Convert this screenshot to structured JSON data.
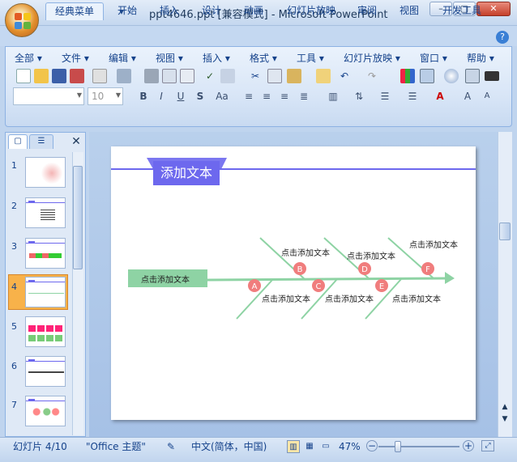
{
  "window": {
    "title": "ppt4646.ppt [兼容模式] - Microsoft PowerPoint",
    "buttons": {
      "minimize": "–",
      "maximize": "▢",
      "close": "✕"
    }
  },
  "quick_access": {
    "save": "💾",
    "undo": "↶",
    "redo": "↻",
    "more": "▾"
  },
  "tabs": [
    {
      "label": "经典菜单",
      "active": true
    },
    {
      "label": "开始"
    },
    {
      "label": "插入"
    },
    {
      "label": "设计"
    },
    {
      "label": "动画"
    },
    {
      "label": "幻灯片放映"
    },
    {
      "label": "审阅"
    },
    {
      "label": "视图"
    },
    {
      "label": "开发工具"
    }
  ],
  "menus": [
    "全部 ▾",
    "文件 ▾",
    "编辑 ▾",
    "视图 ▾",
    "插入 ▾",
    "格式 ▾",
    "工具 ▾",
    "幻灯片放映 ▾",
    "窗口 ▾",
    "帮助 ▾"
  ],
  "font": {
    "name": "",
    "size": "10"
  },
  "format_buttons": [
    "B",
    "I",
    "U",
    "S",
    "Aa"
  ],
  "panel": {
    "close": "✕"
  },
  "slides": [
    {
      "num": "1"
    },
    {
      "num": "2"
    },
    {
      "num": "3"
    },
    {
      "num": "4",
      "selected": true
    },
    {
      "num": "5"
    },
    {
      "num": "6"
    },
    {
      "num": "7"
    }
  ],
  "slide": {
    "title": "添加文本",
    "head_label": "点击添加文本",
    "branches": [
      {
        "letter": "A",
        "label": "点击添加文本"
      },
      {
        "letter": "B",
        "label": "点击添加文本"
      },
      {
        "letter": "C",
        "label": "点击添加文本"
      },
      {
        "letter": "D",
        "label": "点击添加文本"
      },
      {
        "letter": "E",
        "label": "点击添加文本"
      },
      {
        "letter": "F",
        "label": "点击添加文本"
      }
    ]
  },
  "status": {
    "slide_info": "幻灯片 4/10",
    "theme": "\"Office 主题\"",
    "language": "中文(简体，中国)",
    "zoom": "47%",
    "zoom_percent": 47
  },
  "colors": {
    "accent": "#6d68ee",
    "fishbone": "#8ed3a4",
    "circle": "#f07d7d"
  }
}
